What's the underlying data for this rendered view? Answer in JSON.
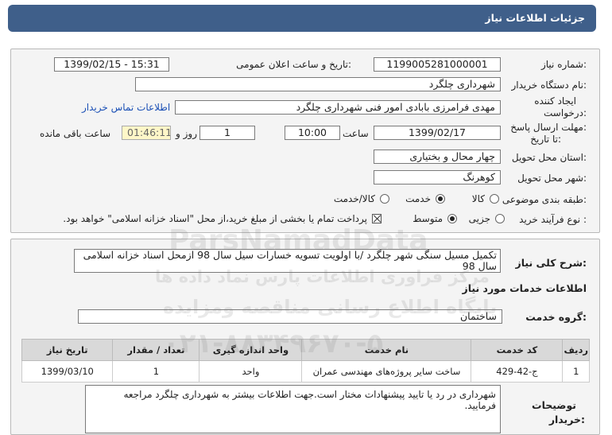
{
  "header": {
    "title": "جزئیات اطلاعات نیاز"
  },
  "form": {
    "need_number_label": "شماره نیاز:",
    "need_number": "1199005281000001",
    "announce_label": "تاریخ و ساعت اعلان عمومی:",
    "announce_value": "1399/02/15 - 15:31",
    "buyer_org_label": "نام دستگاه خریدار:",
    "buyer_org": "شهرداری چلگرد",
    "creator_label_1": "ایجاد کننده",
    "creator_label_2": "درخواست:",
    "creator": "مهدی فرامرزی بابادی امور فنی شهرداری چلگرد",
    "contact_link": "اطلاعات تماس خریدار",
    "deadline_label_1": "مهلت ارسال پاسخ:",
    "deadline_label_2": "تا تاریخ:",
    "deadline_date": "1399/02/17",
    "time_label": "ساعت",
    "deadline_time": "10:00",
    "days_value": "1",
    "days_label": "روز و",
    "remaining_time": "01:46:11",
    "remaining_label": "ساعت باقی مانده",
    "province_label": "استان محل تحویل:",
    "province": "چهار محال و بختیاری",
    "city_label": "شهر محل تحویل:",
    "city": "کوهرنگ",
    "category_label": "طبقه بندی موضوعی:",
    "category_options": [
      "کالا",
      "خدمت",
      "کالا/خدمت"
    ],
    "category_selected": "خدمت",
    "process_label": "نوع فرآیند خرید :",
    "process_options": [
      "جزیی",
      "متوسط"
    ],
    "process_selected": "متوسط",
    "payment_note": "پرداخت تمام یا بخشی از مبلغ خرید،از محل \"اسناد خزانه اسلامی\" خواهد بود."
  },
  "description": {
    "label": "شرح کلی نیاز:",
    "text": "تکمیل مسیل سنگی شهر چلگرد /با اولویت تسویه خسارات سیل سال 98 ازمحل اسناد خزانه اسلامی سال 98"
  },
  "services": {
    "section_title": "اطلاعات خدمات مورد نیاز",
    "group_label": "گروه خدمت:",
    "group_value": "ساختمان",
    "columns": [
      "ردیف",
      "کد خدمت",
      "نام خدمت",
      "واحد اندازه گیری",
      "تعداد / مقدار",
      "تاریخ نیاز"
    ],
    "rows": [
      [
        "1",
        "ج-42-429",
        "ساخت سایر پروژه‌های مهندسی عمران",
        "واحد",
        "1",
        "1399/03/10"
      ]
    ]
  },
  "buyer_notes": {
    "label_1": "توضیحات",
    "label_2": "خریدار:",
    "text": "شهرداری در رد یا تایید پیشنهادات مختار است.جهت اطلاعات بیشتر به شهرداری چلگرد مراجعه فرمایید."
  },
  "watermark": {
    "brand": "ParsNamadData",
    "line1": "مرکز فراوری اطلاعات پارس نماد داده ها",
    "line2": "پایگاه اطلاع رسانی مناقصه ومزایده",
    "phone": "۰۲۱-۸۸۳۴۹۶۷۰-۵"
  }
}
